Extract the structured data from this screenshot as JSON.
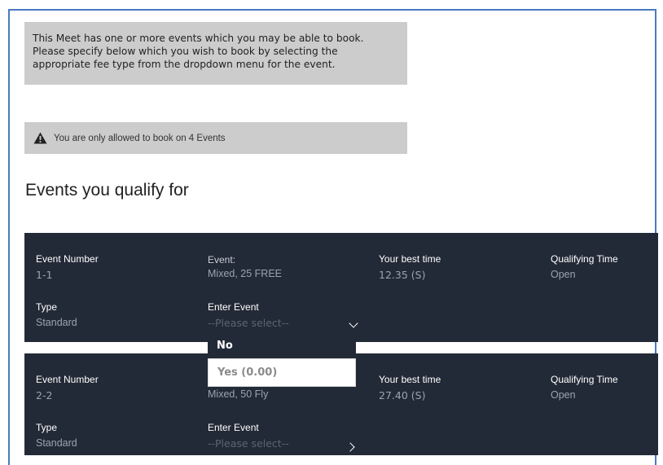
{
  "info": {
    "line1": "This Meet has one or more events which you may be able to book.",
    "line2": "Please specify below which you wish to book by selecting the",
    "line3": "appropriate fee type from the dropdown menu for the event."
  },
  "warning": {
    "icon": "warning-triangle-icon",
    "text": "You are only allowed to book on 4 Events"
  },
  "heading": "Events you qualify for",
  "labels": {
    "event_number": "Event Number",
    "event": "Event:",
    "event_plain": "Event",
    "best_time": "Your best time",
    "qualifying_time": "Qualifying Time",
    "type": "Type",
    "enter_event": "Enter Event",
    "placeholder": "--Please select--"
  },
  "events": [
    {
      "number": "1-1",
      "name": "Mixed, 25 FREE",
      "best_time": "12.35 (S)",
      "qualifying_time": "Open",
      "type": "Standard"
    },
    {
      "number": "2-2",
      "name": "Mixed, 50 Fly",
      "best_time": "27.40 (S)",
      "qualifying_time": "Open",
      "type": "Standard"
    }
  ],
  "dropdown": {
    "options": [
      "No",
      "Yes (0.00)"
    ]
  },
  "colors": {
    "card_bg": "#232a37",
    "info_bg": "#cccccc",
    "frame_border": "#4a7ac0"
  }
}
